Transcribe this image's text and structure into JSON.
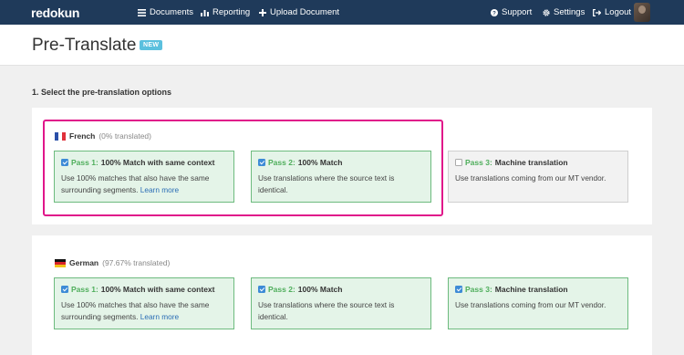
{
  "nav": {
    "logo": "redokun",
    "documents": "Documents",
    "reporting": "Reporting",
    "upload": "Upload Document",
    "support": "Support",
    "settings": "Settings",
    "logout": "Logout"
  },
  "header": {
    "title": "Pre-Translate",
    "badge": "NEW"
  },
  "step": {
    "heading": "1. Select the pre-translation options"
  },
  "languages": [
    {
      "name": "French",
      "percent": "(0% translated)",
      "passes": [
        {
          "num": "Pass 1:",
          "title": "100% Match with same context",
          "checked": true,
          "desc": "Use 100% matches that also have the same surrounding segments.",
          "link": "Learn more"
        },
        {
          "num": "Pass 2:",
          "title": "100% Match",
          "checked": true,
          "desc": "Use translations where the source text is identical."
        },
        {
          "num": "Pass 3:",
          "title": "Machine translation",
          "checked": false,
          "desc": "Use translations coming from our MT vendor."
        }
      ]
    },
    {
      "name": "German",
      "percent": "(97.67% translated)",
      "passes": [
        {
          "num": "Pass 1:",
          "title": "100% Match with same context",
          "checked": true,
          "desc": "Use 100% matches that also have the same surrounding segments.",
          "link": "Learn more"
        },
        {
          "num": "Pass 2:",
          "title": "100% Match",
          "checked": true,
          "desc": "Use translations where the source text is identical."
        },
        {
          "num": "Pass 3:",
          "title": "Machine translation",
          "checked": true,
          "desc": "Use translations coming from our MT vendor."
        }
      ]
    }
  ],
  "colors": {
    "navbar": "#1f3a5a",
    "badge": "#5bc0de",
    "highlight": "#e0168a",
    "pass_green": "#4fae5c",
    "card_bg": "#e4f4e8",
    "card_border": "#6dbb7e",
    "checkbox": "#3d8bd6",
    "link": "#2a6db5"
  },
  "icons": [
    "documents-icon",
    "reporting-icon",
    "upload-plus-icon",
    "support-icon",
    "settings-gear-icon",
    "logout-icon",
    "avatar",
    "french-flag-icon",
    "german-flag-icon",
    "checkbox-icon"
  ]
}
